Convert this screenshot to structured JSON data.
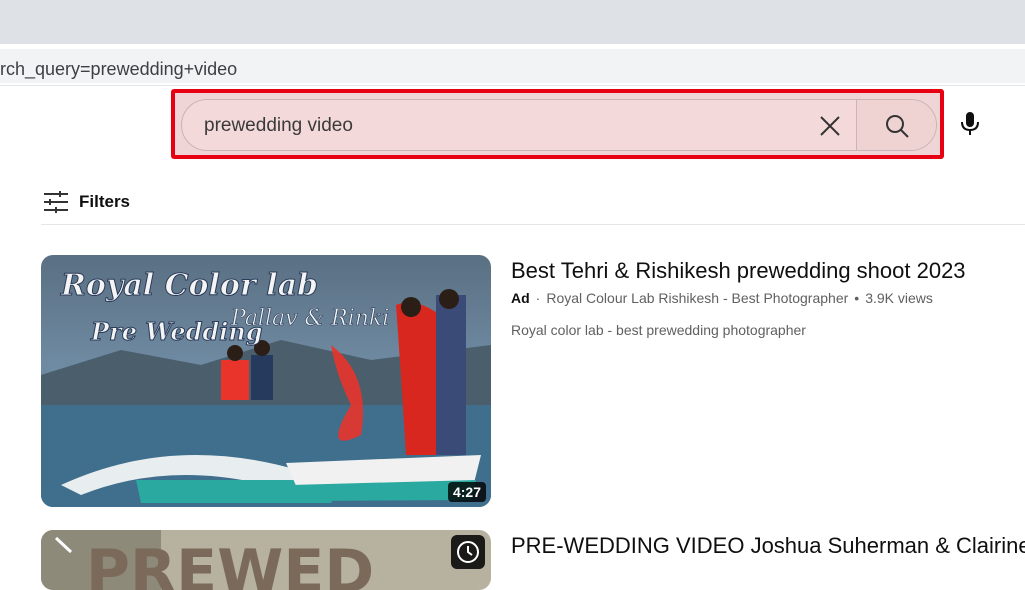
{
  "browser": {
    "url_text": "rch_query=prewedding+video"
  },
  "search": {
    "query": "prewedding video",
    "clear_icon": "close-icon",
    "search_icon": "search-icon",
    "mic_icon": "mic-icon"
  },
  "filters": {
    "label": "Filters",
    "icon": "sliders-icon"
  },
  "results": [
    {
      "title": "Best Tehri & Rishikesh prewedding shoot 2023",
      "ad_label": "Ad",
      "channel": "Royal Colour Lab Rishikesh - Best Photographer",
      "views": "3.9K views",
      "description": "Royal color lab - best prewedding photographer",
      "duration": "4:27",
      "thumb_text_1": "Royal Color lab",
      "thumb_text_2": "Pre Wedding",
      "thumb_text_3": "Pallav & Rinki"
    },
    {
      "title": "PRE-WEDDING VIDEO Joshua Suherman & Clairine C",
      "thumb_text": "PREWED"
    }
  ],
  "colors": {
    "highlight_border": "#e60012",
    "highlight_fill": "#efd5d5"
  }
}
